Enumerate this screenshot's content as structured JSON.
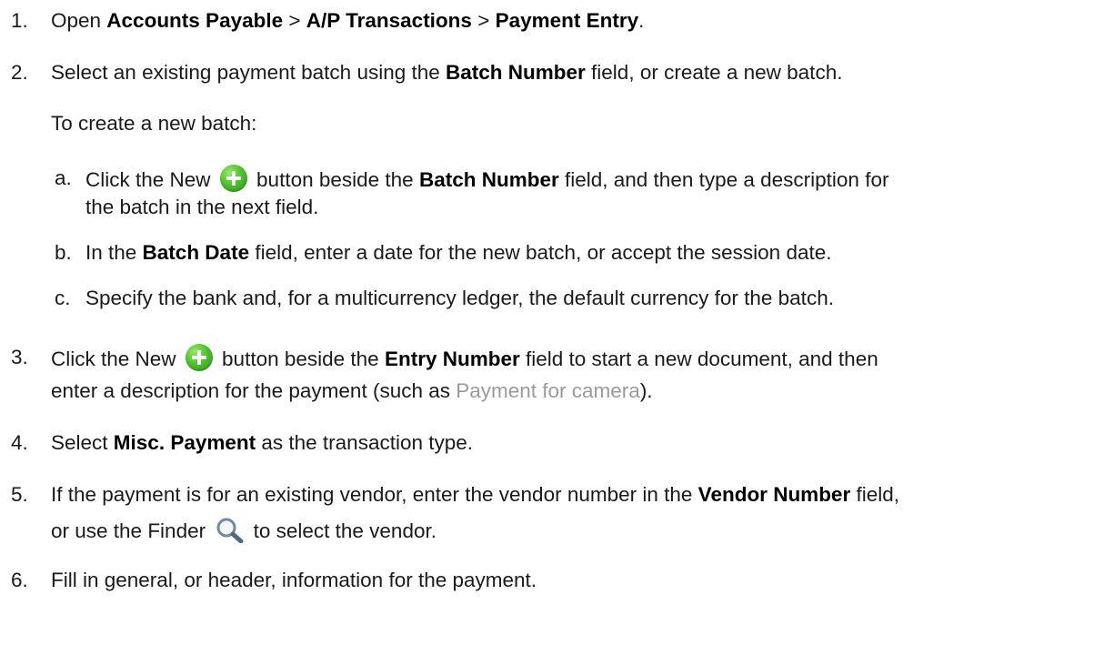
{
  "steps": [
    {
      "num": "1.",
      "t1": "Open ",
      "b1": "Accounts Payable",
      "t2": " > ",
      "b2": "A/P Transactions",
      "t3": " > ",
      "b3": "Payment Entry",
      "t4": "."
    },
    {
      "num": "2.",
      "t1": "Select an existing payment batch using the ",
      "b1": "Batch Number",
      "t2": " field, or create a new batch."
    },
    {
      "intro": "To create a new batch:"
    },
    {
      "num": "a.",
      "t1": "Click the New ",
      "t2": " button beside the ",
      "b1": "Batch Number",
      "t3": " field, and then type a description for",
      "cont": "the batch in the next field."
    },
    {
      "num": "b.",
      "t1": "In the ",
      "b1": "Batch Date",
      "t2": " field, enter a date for the new batch, or accept the session date."
    },
    {
      "num": "c.",
      "t1": "Specify the bank and, for a multicurrency ledger, the default currency for the batch."
    },
    {
      "num": "3.",
      "t1": "Click the New ",
      "t2": " button beside the ",
      "b1": "Entry Number",
      "t3": " field to start a new document, and then",
      "cont1": "enter a description for the payment (such as ",
      "example": "Payment for camera",
      "cont2": ")."
    },
    {
      "num": "4.",
      "t1": "Select ",
      "b1": "Misc. Payment",
      "t2": " as the transaction type."
    },
    {
      "num": "5.",
      "t1": "If the payment is for an existing vendor, enter the vendor number in the ",
      "b1": "Vendor Number",
      "t2": " field,",
      "cont1": "or use the Finder ",
      "cont2": " to select the vendor."
    },
    {
      "num": "6.",
      "t1": "Fill in general, or header, information for the payment."
    }
  ],
  "icons": {
    "add": "add-new-icon",
    "finder": "finder-search-icon"
  },
  "colors": {
    "add_icon": "#4cc22a",
    "example_text": "#9a9a9a"
  }
}
